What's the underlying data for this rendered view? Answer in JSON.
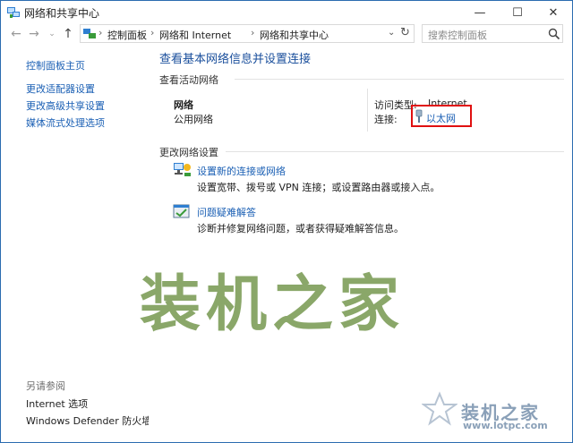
{
  "window": {
    "title": "网络和共享中心",
    "controls": {
      "minimize": "—",
      "maximize": "☐",
      "close": "✕"
    }
  },
  "address_bar": {
    "breadcrumbs": [
      "控制面板",
      "网络和 Internet",
      "网络和共享中心"
    ],
    "search_placeholder": "搜索控制面板"
  },
  "sidebar": {
    "home_link": "控制面板主页",
    "links": [
      "更改适配器设置",
      "更改高级共享设置",
      "媒体流式处理选项"
    ],
    "see_also_heading": "另请参阅",
    "see_also_links": [
      "Internet 选项",
      "Windows Defender 防火墙"
    ]
  },
  "main": {
    "page_title": "查看基本网络信息并设置连接",
    "active_networks_heading": "查看活动网络",
    "network": {
      "name": "网络",
      "type": "公用网络",
      "access_type_label": "访问类型:",
      "access_type_value": "Internet",
      "connections_label": "连接:",
      "connection_link": "以太网"
    },
    "change_settings_heading": "更改网络设置",
    "tasks": [
      {
        "title": "设置新的连接或网络",
        "description": "设置宽带、拨号或 VPN 连接；或设置路由器或接入点。",
        "icon": "network-setup-icon"
      },
      {
        "title": "问题疑难解答",
        "description": "诊断并修复网络问题，或者获得疑难解答信息。",
        "icon": "troubleshoot-icon"
      }
    ]
  },
  "watermark": {
    "text": "装机之家",
    "logo_text": "装机之家",
    "logo_url": "www.lotpc.com"
  },
  "colors": {
    "link": "#1a5fb4",
    "highlight_box": "#e01010",
    "watermark": "#7b9b55"
  }
}
